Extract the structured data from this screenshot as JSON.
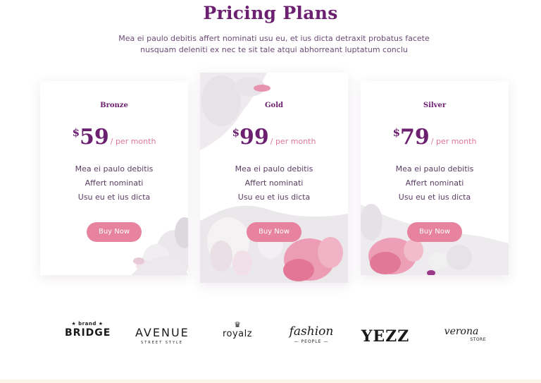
{
  "section": {
    "title": "Pricing Plans",
    "subtitle": "Mea ei paulo debitis affert nominati usu eu, et ius dicta detraxit probatus facete nusquam deleniti ex nec te sit tale atqui abhorreant luptatum conclu"
  },
  "plans": [
    {
      "name": "Bronze",
      "currency": "$",
      "amount": "59",
      "period": "/ per month",
      "features": [
        "Mea ei paulo debitis",
        "Affert nominati",
        "Usu eu et ius dicta"
      ],
      "button_label": "Buy Now"
    },
    {
      "name": "Gold",
      "currency": "$",
      "amount": "99",
      "period": "/ per month",
      "features": [
        "Mea ei paulo debitis",
        "Affert nominati",
        "Usu eu et ius dicta"
      ],
      "button_label": "Buy Now"
    },
    {
      "name": "Silver",
      "currency": "$",
      "amount": "79",
      "period": "/ per month",
      "features": [
        "Mea ei paulo debitis",
        "Affert nominati",
        "Usu eu et ius dicta"
      ],
      "button_label": "Buy Now"
    }
  ],
  "logos": [
    {
      "icon": "star-icon",
      "top": "★ brand ★",
      "main": "BRIDGE"
    },
    {
      "main": "AVENUE",
      "sub": "STREET STYLE"
    },
    {
      "icon": "crown-icon",
      "main": "royalz"
    },
    {
      "main": "fashion",
      "sub": "— PEOPLE —"
    },
    {
      "main": "YEZZ"
    },
    {
      "main": "verona",
      "sub": "STORE"
    }
  ],
  "colors": {
    "accent_purple": "#6b2070",
    "accent_pink": "#e8839f",
    "text": "#5a3d63"
  }
}
